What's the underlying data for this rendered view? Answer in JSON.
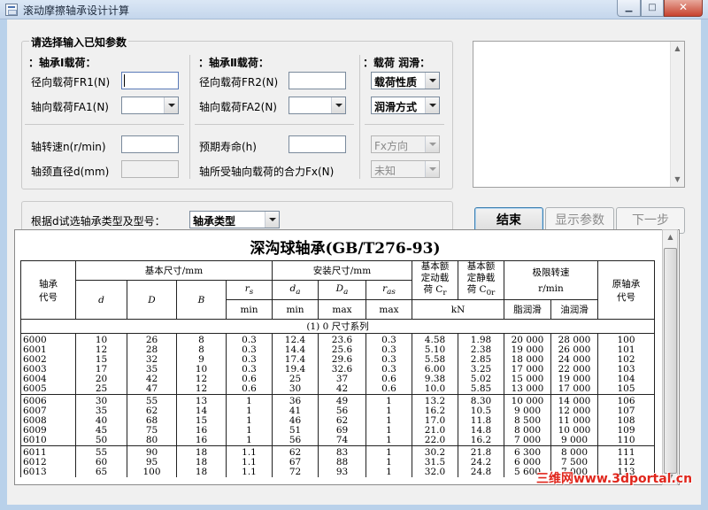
{
  "window": {
    "title": "滚动摩擦轴承设计计算",
    "min": "▁",
    "max": "□",
    "close": "✕"
  },
  "input_group": {
    "title": "请选择输入已知参数",
    "bearing1": {
      "heading": "：轴承Ⅰ载荷：",
      "fr_label": "径向载荷FR1(N)",
      "fa_label": "轴向载荷FA1(N)"
    },
    "bearing2": {
      "heading": "：轴承Ⅱ载荷：",
      "fr_label": "径向载荷FR2(N)",
      "fa_label": "轴向载荷FA2(N)"
    },
    "load": {
      "heading": "：载荷 润滑：",
      "nature": "载荷性质",
      "lube": "润滑方式"
    },
    "speed_label": "轴转速n(r/min)",
    "diameter_label": "轴颈直径d(mm)",
    "life_label": "预期寿命(h)",
    "fx_label": "轴所受轴向载荷的合力Fx(N)",
    "fx_dir": "Fx方向",
    "unknown": "未知"
  },
  "select_group": {
    "label": "根据d试选轴承类型及型号：",
    "type": "轴承类型"
  },
  "buttons": {
    "finish": "结束",
    "show": "显示参数",
    "next": "下一步"
  },
  "table": {
    "title": "深沟球轴承(GB/T276-93)",
    "h_code": [
      "轴承",
      "代号"
    ],
    "h_basic": "基本尺寸/mm",
    "h_install": "安装尺寸/mm",
    "h_dyn": [
      "基本额",
      "定动载",
      "荷 C"
    ],
    "h_dyn_sub": "r",
    "h_stat": [
      "基本额",
      "定静载",
      "荷 C"
    ],
    "h_stat_sub": "0r",
    "h_speed": "极限转速",
    "h_speed_unit": "r/min",
    "h_old": [
      "原轴承",
      "代号"
    ],
    "cols": [
      "d",
      "D",
      "B",
      "r",
      "d",
      "D",
      "r"
    ],
    "col_subs": [
      "",
      "",
      "",
      "s",
      "a",
      "a",
      "as"
    ],
    "limits": [
      "min",
      "min",
      "max",
      "max"
    ],
    "kn": "kN",
    "grease": "脂润滑",
    "oil": "油润滑",
    "section": "(1) 0 尺寸系列",
    "groups": [
      [
        [
          "6000",
          "10",
          "26",
          "8",
          "0.3",
          "12.4",
          "23.6",
          "0.3",
          "4.58",
          "1.98",
          "20 000",
          "28 000",
          "100"
        ],
        [
          "6001",
          "12",
          "28",
          "8",
          "0.3",
          "14.4",
          "25.6",
          "0.3",
          "5.10",
          "2.38",
          "19 000",
          "26 000",
          "101"
        ],
        [
          "6002",
          "15",
          "32",
          "9",
          "0.3",
          "17.4",
          "29.6",
          "0.3",
          "5.58",
          "2.85",
          "18 000",
          "24 000",
          "102"
        ],
        [
          "6003",
          "17",
          "35",
          "10",
          "0.3",
          "19.4",
          "32.6",
          "0.3",
          "6.00",
          "3.25",
          "17 000",
          "22 000",
          "103"
        ],
        [
          "6004",
          "20",
          "42",
          "12",
          "0.6",
          "25",
          "37",
          "0.6",
          "9.38",
          "5.02",
          "15 000",
          "19 000",
          "104"
        ],
        [
          "6005",
          "25",
          "47",
          "12",
          "0.6",
          "30",
          "42",
          "0.6",
          "10.0",
          "5.85",
          "13 000",
          "17 000",
          "105"
        ]
      ],
      [
        [
          "6006",
          "30",
          "55",
          "13",
          "1",
          "36",
          "49",
          "1",
          "13.2",
          "8.30",
          "10 000",
          "14 000",
          "106"
        ],
        [
          "6007",
          "35",
          "62",
          "14",
          "1",
          "41",
          "56",
          "1",
          "16.2",
          "10.5",
          "9 000",
          "12 000",
          "107"
        ],
        [
          "6008",
          "40",
          "68",
          "15",
          "1",
          "46",
          "62",
          "1",
          "17.0",
          "11.8",
          "8 500",
          "11 000",
          "108"
        ],
        [
          "6009",
          "45",
          "75",
          "16",
          "1",
          "51",
          "69",
          "1",
          "21.0",
          "14.8",
          "8 000",
          "10 000",
          "109"
        ],
        [
          "6010",
          "50",
          "80",
          "16",
          "1",
          "56",
          "74",
          "1",
          "22.0",
          "16.2",
          "7 000",
          "9 000",
          "110"
        ]
      ],
      [
        [
          "6011",
          "55",
          "90",
          "18",
          "1.1",
          "62",
          "83",
          "1",
          "30.2",
          "21.8",
          "6 300",
          "8 000",
          "111"
        ],
        [
          "6012",
          "60",
          "95",
          "18",
          "1.1",
          "67",
          "88",
          "1",
          "31.5",
          "24.2",
          "6 000",
          "7 500",
          "112"
        ],
        [
          "6013",
          "65",
          "100",
          "18",
          "1.1",
          "72",
          "93",
          "1",
          "32.0",
          "24.8",
          "5 600",
          "7 000",
          "113"
        ]
      ]
    ]
  },
  "watermark": "三维网www.3dportal.cn"
}
